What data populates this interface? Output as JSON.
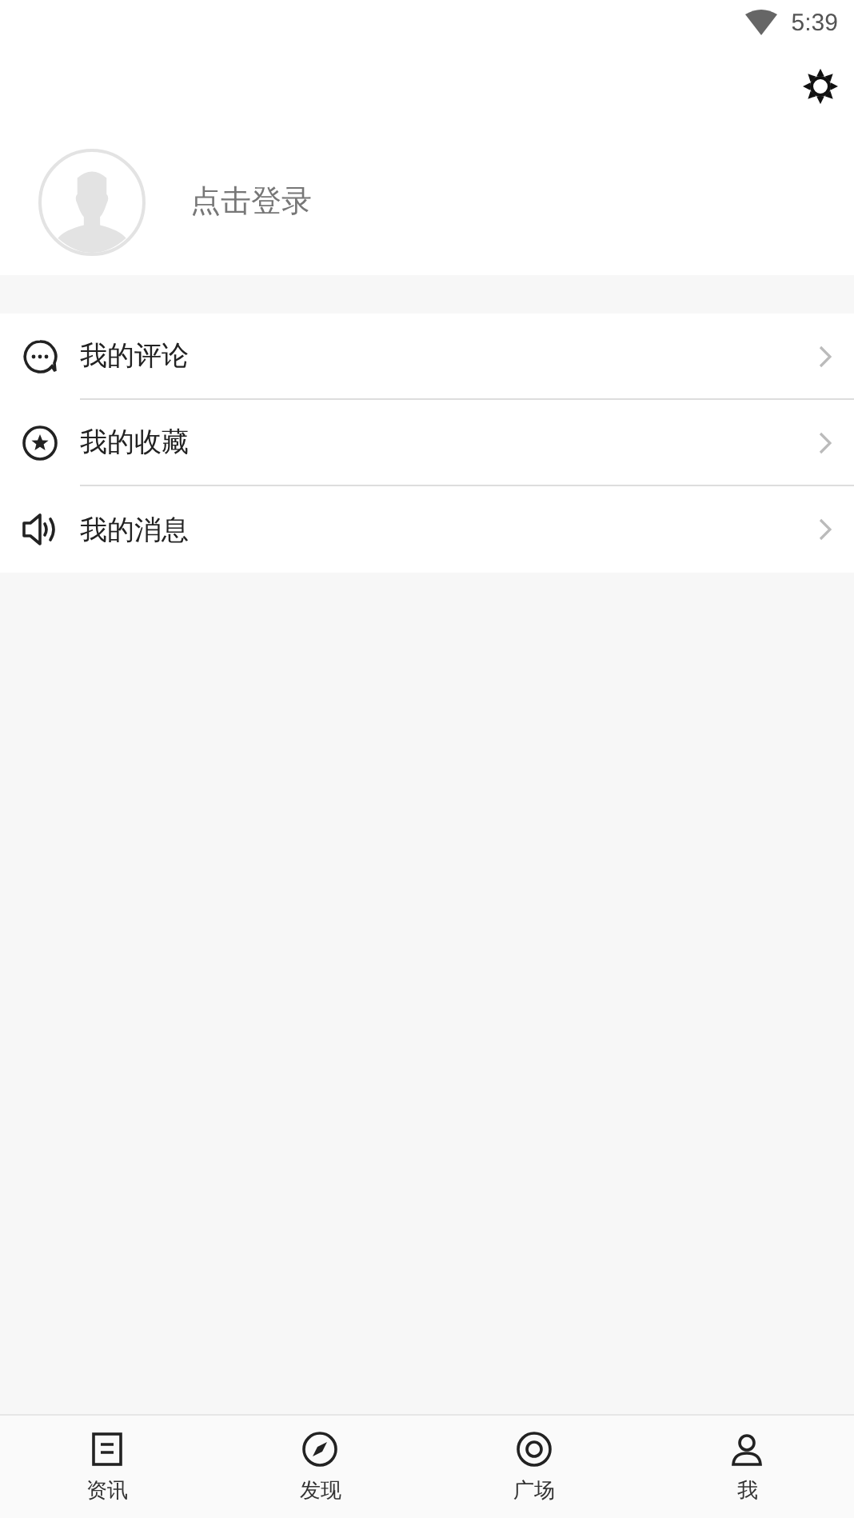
{
  "status_bar": {
    "time": "5:39"
  },
  "profile": {
    "login_prompt": "点击登录"
  },
  "menu": [
    {
      "kind": "comment",
      "label": "我的评论"
    },
    {
      "kind": "star",
      "label": "我的收藏"
    },
    {
      "kind": "speaker",
      "label": "我的消息"
    }
  ],
  "bottom_nav": [
    {
      "kind": "news",
      "label": "资讯"
    },
    {
      "kind": "discover",
      "label": "发现"
    },
    {
      "kind": "square",
      "label": "广场"
    },
    {
      "kind": "me",
      "label": "我"
    }
  ]
}
